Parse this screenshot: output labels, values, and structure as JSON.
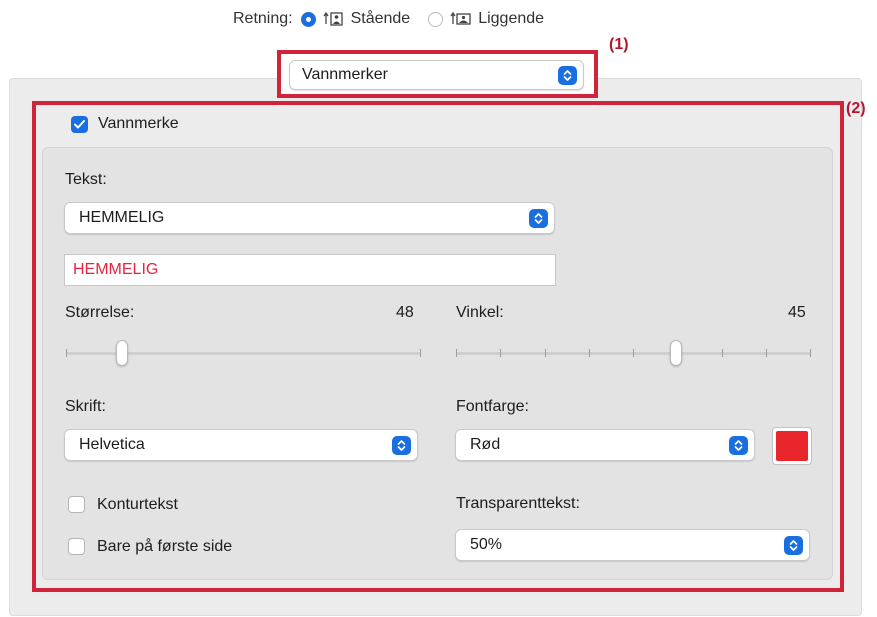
{
  "orientation": {
    "label": "Retning:",
    "options": [
      {
        "label": "Stående",
        "selected": true
      },
      {
        "label": "Liggende",
        "selected": false
      }
    ]
  },
  "annotations": {
    "one": "(1)",
    "two": "(2)",
    "color": "#d0243b"
  },
  "section_popup": {
    "value": "Vannmerker"
  },
  "watermark": {
    "enabled_label": "Vannmerke",
    "enabled": true,
    "text_label": "Tekst:",
    "text_popup_value": "HEMMELIG",
    "text_field_value": "HEMMELIG",
    "size_label": "Størrelse:",
    "size_value": "48",
    "angle_label": "Vinkel:",
    "angle_value": "45",
    "font_label": "Skrift:",
    "font_value": "Helvetica",
    "font_color_label": "Fontfarge:",
    "font_color_value": "Rød",
    "font_color_hex": "#e8262b",
    "outline_label": "Konturtekst",
    "outline_checked": false,
    "first_page_label": "Bare på første side",
    "first_page_checked": false,
    "transparency_label": "Transparenttekst:",
    "transparency_value": "50%"
  },
  "colors": {
    "accent": "#1a6fe0",
    "watermark_text": "#e8243f"
  }
}
